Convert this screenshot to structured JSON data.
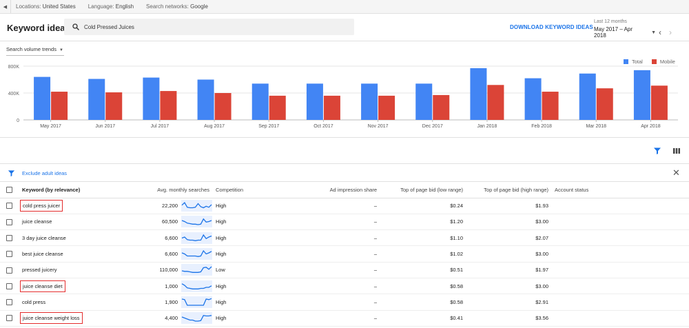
{
  "topbar": {
    "location_label": "Locations:",
    "location_value": "United States",
    "language_label": "Language:",
    "language_value": "English",
    "network_label": "Search networks:",
    "network_value": "Google"
  },
  "header": {
    "title": "Keyword ideas",
    "search_value": "Cold Pressed Juices",
    "download_label": "DOWNLOAD KEYWORD IDEAS",
    "range_label": "Last 12 months",
    "range_value": "May 2017 – Apr 2018"
  },
  "trends": {
    "dropdown_label": "Search volume trends",
    "legend": [
      {
        "name": "Total",
        "color": "#4285f4"
      },
      {
        "name": "Mobile",
        "color": "#db4437"
      }
    ]
  },
  "chart_data": {
    "type": "bar",
    "categories": [
      "May 2017",
      "Jun 2017",
      "Jul 2017",
      "Aug 2017",
      "Sep 2017",
      "Oct 2017",
      "Nov 2017",
      "Dec 2017",
      "Jan 2018",
      "Feb 2018",
      "Mar 2018",
      "Apr 2018"
    ],
    "series": [
      {
        "name": "Total",
        "color": "#4285f4",
        "values": [
          640000,
          610000,
          630000,
          600000,
          540000,
          540000,
          540000,
          540000,
          770000,
          620000,
          690000,
          740000
        ]
      },
      {
        "name": "Mobile",
        "color": "#db4437",
        "values": [
          420000,
          410000,
          430000,
          400000,
          360000,
          360000,
          360000,
          370000,
          520000,
          420000,
          470000,
          510000
        ]
      }
    ],
    "ylim": [
      0,
      800000
    ],
    "yticks": [
      "0",
      "400K",
      "800K"
    ],
    "grid": true,
    "legend_position": "top-right"
  },
  "filter": {
    "label": "Exclude adult ideas"
  },
  "table": {
    "columns": {
      "keyword": "Keyword (by relevance)",
      "avg": "Avg. monthly searches",
      "competition": "Competition",
      "ad_share": "Ad impression share",
      "bid_low": "Top of page bid (low range)",
      "bid_high": "Top of page bid (high range)",
      "status": "Account status"
    },
    "rows": [
      {
        "keyword": "cold press juicer",
        "avg": "22,200",
        "competition": "High",
        "ad_share": "–",
        "bid_low": "$0.24",
        "bid_high": "$1.93",
        "highlight": true,
        "trend": [
          0.55,
          0.8,
          0.35,
          0.3,
          0.3,
          0.35,
          0.7,
          0.4,
          0.3,
          0.45,
          0.35,
          0.6
        ]
      },
      {
        "keyword": "juice cleanse",
        "avg": "60,500",
        "competition": "High",
        "ad_share": "–",
        "bid_low": "$1.20",
        "bid_high": "$3.00",
        "highlight": false,
        "trend": [
          0.6,
          0.5,
          0.35,
          0.3,
          0.25,
          0.25,
          0.2,
          0.25,
          0.75,
          0.45,
          0.5,
          0.6
        ]
      },
      {
        "keyword": "3 day juice cleanse",
        "avg": "6,600",
        "competition": "High",
        "ad_share": "–",
        "bid_low": "$1.10",
        "bid_high": "$2.07",
        "highlight": false,
        "trend": [
          0.5,
          0.6,
          0.35,
          0.3,
          0.3,
          0.25,
          0.3,
          0.3,
          0.8,
          0.45,
          0.6,
          0.7
        ]
      },
      {
        "keyword": "best juice cleanse",
        "avg": "6,600",
        "competition": "High",
        "ad_share": "–",
        "bid_low": "$1.02",
        "bid_high": "$3.00",
        "highlight": false,
        "trend": [
          0.6,
          0.5,
          0.3,
          0.3,
          0.3,
          0.3,
          0.25,
          0.3,
          0.8,
          0.5,
          0.6,
          0.75
        ]
      },
      {
        "keyword": "pressed juicery",
        "avg": "110,000",
        "competition": "Low",
        "ad_share": "–",
        "bid_low": "$0.51",
        "bid_high": "$1.97",
        "highlight": false,
        "trend": [
          0.4,
          0.35,
          0.35,
          0.3,
          0.25,
          0.25,
          0.25,
          0.3,
          0.7,
          0.75,
          0.55,
          0.8
        ]
      },
      {
        "keyword": "juice cleanse diet",
        "avg": "1,000",
        "competition": "High",
        "ad_share": "–",
        "bid_low": "$0.58",
        "bid_high": "$3.00",
        "highlight": true,
        "trend": [
          0.75,
          0.6,
          0.35,
          0.3,
          0.25,
          0.25,
          0.25,
          0.3,
          0.3,
          0.4,
          0.4,
          0.55
        ]
      },
      {
        "keyword": "cold press",
        "avg": "1,900",
        "competition": "High",
        "ad_share": "–",
        "bid_low": "$0.58",
        "bid_high": "$2.91",
        "highlight": false,
        "trend": [
          0.8,
          0.75,
          0.2,
          0.2,
          0.2,
          0.2,
          0.2,
          0.2,
          0.2,
          0.8,
          0.75,
          0.85
        ]
      },
      {
        "keyword": "juice cleanse weight loss",
        "avg": "4,400",
        "competition": "High",
        "ad_share": "–",
        "bid_low": "$0.41",
        "bid_high": "$3.56",
        "highlight": true,
        "trend": [
          0.6,
          0.5,
          0.4,
          0.3,
          0.3,
          0.2,
          0.2,
          0.25,
          0.75,
          0.7,
          0.7,
          0.75
        ]
      }
    ]
  }
}
